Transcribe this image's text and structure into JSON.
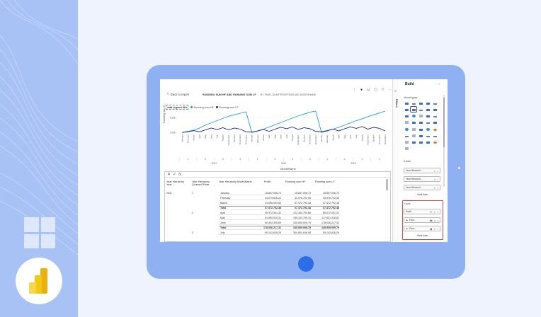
{
  "report": {
    "back_label": "Back to report",
    "chart_title": "RUNNING SUM HF AND RUNNING SUM LF",
    "chart_subtitle": "BY YEAR, QUARTEROFYEAR AND MONTHNAME",
    "legend_title": "Add legend title",
    "legend_items": [
      "Running sum HF",
      "Running sum LF"
    ],
    "y_axis_title": "Running sum H...",
    "x_axis_title": "MonthName"
  },
  "chart_data": {
    "type": "line",
    "ylim": [
      0,
      300
    ],
    "y_ticks": [
      "0,0bn",
      "0,2bn"
    ],
    "x": [
      "January",
      "February",
      "March",
      "April",
      "May",
      "June",
      "July",
      "August",
      "September",
      "October",
      "November",
      "December",
      "January",
      "February",
      "March",
      "April",
      "May",
      "June",
      "July",
      "August",
      "September",
      "October",
      "November",
      "December",
      "January",
      "February",
      "March",
      "April",
      "May",
      "June",
      "July",
      "August",
      "September",
      "October",
      "November",
      "December"
    ],
    "quarters": [
      "1",
      "2",
      "3",
      "4",
      "1",
      "2",
      "3",
      "4",
      "1",
      "2",
      "3",
      "4"
    ],
    "years": [
      "2011",
      "2012",
      "2013"
    ],
    "series": [
      {
        "name": "Running sum HF",
        "color": "#2196e3",
        "values": [
          0,
          15,
          30,
          60,
          100,
          130,
          160,
          190,
          220,
          240,
          260,
          280,
          0,
          20,
          45,
          75,
          105,
          135,
          165,
          195,
          225,
          250,
          275,
          290,
          0,
          20,
          45,
          70,
          100,
          130,
          160,
          185,
          215,
          240,
          265,
          290
        ]
      },
      {
        "name": "Running sum LF",
        "color": "#1a237e",
        "values": [
          0,
          10,
          25,
          10,
          35,
          60,
          40,
          65,
          35,
          60,
          45,
          10,
          5,
          20,
          40,
          15,
          45,
          70,
          50,
          75,
          40,
          65,
          50,
          15,
          10,
          25,
          45,
          20,
          50,
          75,
          55,
          80,
          45,
          70,
          55,
          20
        ]
      }
    ]
  },
  "table": {
    "headers": [
      "Year Hierarchy Year",
      "Year Hierarchy QuarterOfYear",
      "Year Hierarchy MonthName",
      "Profit",
      "Running sum HF",
      "Running sum LF"
    ],
    "rows": [
      {
        "year": "2011",
        "quarter": "1",
        "month": "January",
        "profit": "15.897.006,73",
        "hf": "15.897.006,73",
        "lf": "15.897.006,73",
        "total": false
      },
      {
        "year": "",
        "quarter": "",
        "month": "February",
        "profit": "24.079.616,22",
        "hf": "43.976.702,95",
        "lf": "43.976.702,95",
        "total": false
      },
      {
        "year": "",
        "quarter": "",
        "month": "March",
        "profit": "23.496.099,53",
        "hf": "67.472.792,48",
        "lf": "67.472.792,48",
        "total": false
      },
      {
        "year": "",
        "quarter": "",
        "month": "Total",
        "profit": "67.472.792,48",
        "hf": "67.472.792,48",
        "lf": "67.472.792,48",
        "total": true
      },
      {
        "year": "",
        "quarter": "2",
        "month": "April",
        "profit": "55.972.001,32",
        "hf": "123.444.793,80",
        "lf": "55.972.001,32",
        "total": false
      },
      {
        "year": "",
        "quarter": "",
        "month": "May",
        "profit": "61.659.915,31",
        "hf": "185.104.709,10",
        "lf": "117.631.916,62",
        "total": false
      },
      {
        "year": "",
        "quarter": "",
        "month": "June",
        "profit": "60.404.305,69",
        "hf": "245.509.009,79",
        "lf": "178.036.217,31",
        "total": false
      },
      {
        "year": "",
        "quarter": "",
        "month": "Total",
        "profit": "178.036.217,31",
        "hf": "245.509.009,79",
        "lf": "245.509.009,79",
        "total": true
      },
      {
        "year": "",
        "quarter": "3",
        "month": "July",
        "profit": "55.142.626,29",
        "hf": "300.651.636,08",
        "lf": "55.142.626,29",
        "total": false
      }
    ]
  },
  "build": {
    "title": "Build",
    "more": "···  »",
    "visual_types_label": "Visual types",
    "x_axis_label": "X-axis",
    "x_axis_fields": [
      "Year Hierarch...",
      "Year Hierarch...",
      "Year Hierarch..."
    ],
    "y_axis_label": "Y-axis",
    "y_axis_fields": [
      "Profit",
      "Run...",
      "Run..."
    ],
    "add_data": "+Add data"
  },
  "rail": {
    "filters_label": "Filters"
  }
}
